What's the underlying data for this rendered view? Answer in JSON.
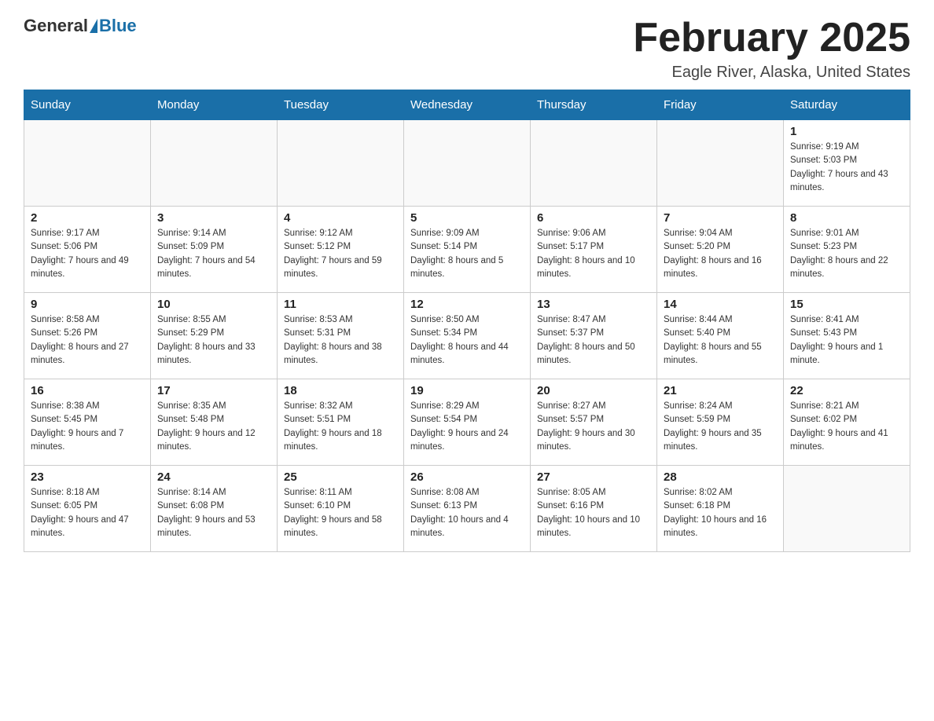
{
  "header": {
    "logo_general": "General",
    "logo_blue": "Blue",
    "title": "February 2025",
    "location": "Eagle River, Alaska, United States"
  },
  "weekdays": [
    "Sunday",
    "Monday",
    "Tuesday",
    "Wednesday",
    "Thursday",
    "Friday",
    "Saturday"
  ],
  "weeks": [
    [
      {
        "day": "",
        "sunrise": "",
        "sunset": "",
        "daylight": ""
      },
      {
        "day": "",
        "sunrise": "",
        "sunset": "",
        "daylight": ""
      },
      {
        "day": "",
        "sunrise": "",
        "sunset": "",
        "daylight": ""
      },
      {
        "day": "",
        "sunrise": "",
        "sunset": "",
        "daylight": ""
      },
      {
        "day": "",
        "sunrise": "",
        "sunset": "",
        "daylight": ""
      },
      {
        "day": "",
        "sunrise": "",
        "sunset": "",
        "daylight": ""
      },
      {
        "day": "1",
        "sunrise": "Sunrise: 9:19 AM",
        "sunset": "Sunset: 5:03 PM",
        "daylight": "Daylight: 7 hours and 43 minutes."
      }
    ],
    [
      {
        "day": "2",
        "sunrise": "Sunrise: 9:17 AM",
        "sunset": "Sunset: 5:06 PM",
        "daylight": "Daylight: 7 hours and 49 minutes."
      },
      {
        "day": "3",
        "sunrise": "Sunrise: 9:14 AM",
        "sunset": "Sunset: 5:09 PM",
        "daylight": "Daylight: 7 hours and 54 minutes."
      },
      {
        "day": "4",
        "sunrise": "Sunrise: 9:12 AM",
        "sunset": "Sunset: 5:12 PM",
        "daylight": "Daylight: 7 hours and 59 minutes."
      },
      {
        "day": "5",
        "sunrise": "Sunrise: 9:09 AM",
        "sunset": "Sunset: 5:14 PM",
        "daylight": "Daylight: 8 hours and 5 minutes."
      },
      {
        "day": "6",
        "sunrise": "Sunrise: 9:06 AM",
        "sunset": "Sunset: 5:17 PM",
        "daylight": "Daylight: 8 hours and 10 minutes."
      },
      {
        "day": "7",
        "sunrise": "Sunrise: 9:04 AM",
        "sunset": "Sunset: 5:20 PM",
        "daylight": "Daylight: 8 hours and 16 minutes."
      },
      {
        "day": "8",
        "sunrise": "Sunrise: 9:01 AM",
        "sunset": "Sunset: 5:23 PM",
        "daylight": "Daylight: 8 hours and 22 minutes."
      }
    ],
    [
      {
        "day": "9",
        "sunrise": "Sunrise: 8:58 AM",
        "sunset": "Sunset: 5:26 PM",
        "daylight": "Daylight: 8 hours and 27 minutes."
      },
      {
        "day": "10",
        "sunrise": "Sunrise: 8:55 AM",
        "sunset": "Sunset: 5:29 PM",
        "daylight": "Daylight: 8 hours and 33 minutes."
      },
      {
        "day": "11",
        "sunrise": "Sunrise: 8:53 AM",
        "sunset": "Sunset: 5:31 PM",
        "daylight": "Daylight: 8 hours and 38 minutes."
      },
      {
        "day": "12",
        "sunrise": "Sunrise: 8:50 AM",
        "sunset": "Sunset: 5:34 PM",
        "daylight": "Daylight: 8 hours and 44 minutes."
      },
      {
        "day": "13",
        "sunrise": "Sunrise: 8:47 AM",
        "sunset": "Sunset: 5:37 PM",
        "daylight": "Daylight: 8 hours and 50 minutes."
      },
      {
        "day": "14",
        "sunrise": "Sunrise: 8:44 AM",
        "sunset": "Sunset: 5:40 PM",
        "daylight": "Daylight: 8 hours and 55 minutes."
      },
      {
        "day": "15",
        "sunrise": "Sunrise: 8:41 AM",
        "sunset": "Sunset: 5:43 PM",
        "daylight": "Daylight: 9 hours and 1 minute."
      }
    ],
    [
      {
        "day": "16",
        "sunrise": "Sunrise: 8:38 AM",
        "sunset": "Sunset: 5:45 PM",
        "daylight": "Daylight: 9 hours and 7 minutes."
      },
      {
        "day": "17",
        "sunrise": "Sunrise: 8:35 AM",
        "sunset": "Sunset: 5:48 PM",
        "daylight": "Daylight: 9 hours and 12 minutes."
      },
      {
        "day": "18",
        "sunrise": "Sunrise: 8:32 AM",
        "sunset": "Sunset: 5:51 PM",
        "daylight": "Daylight: 9 hours and 18 minutes."
      },
      {
        "day": "19",
        "sunrise": "Sunrise: 8:29 AM",
        "sunset": "Sunset: 5:54 PM",
        "daylight": "Daylight: 9 hours and 24 minutes."
      },
      {
        "day": "20",
        "sunrise": "Sunrise: 8:27 AM",
        "sunset": "Sunset: 5:57 PM",
        "daylight": "Daylight: 9 hours and 30 minutes."
      },
      {
        "day": "21",
        "sunrise": "Sunrise: 8:24 AM",
        "sunset": "Sunset: 5:59 PM",
        "daylight": "Daylight: 9 hours and 35 minutes."
      },
      {
        "day": "22",
        "sunrise": "Sunrise: 8:21 AM",
        "sunset": "Sunset: 6:02 PM",
        "daylight": "Daylight: 9 hours and 41 minutes."
      }
    ],
    [
      {
        "day": "23",
        "sunrise": "Sunrise: 8:18 AM",
        "sunset": "Sunset: 6:05 PM",
        "daylight": "Daylight: 9 hours and 47 minutes."
      },
      {
        "day": "24",
        "sunrise": "Sunrise: 8:14 AM",
        "sunset": "Sunset: 6:08 PM",
        "daylight": "Daylight: 9 hours and 53 minutes."
      },
      {
        "day": "25",
        "sunrise": "Sunrise: 8:11 AM",
        "sunset": "Sunset: 6:10 PM",
        "daylight": "Daylight: 9 hours and 58 minutes."
      },
      {
        "day": "26",
        "sunrise": "Sunrise: 8:08 AM",
        "sunset": "Sunset: 6:13 PM",
        "daylight": "Daylight: 10 hours and 4 minutes."
      },
      {
        "day": "27",
        "sunrise": "Sunrise: 8:05 AM",
        "sunset": "Sunset: 6:16 PM",
        "daylight": "Daylight: 10 hours and 10 minutes."
      },
      {
        "day": "28",
        "sunrise": "Sunrise: 8:02 AM",
        "sunset": "Sunset: 6:18 PM",
        "daylight": "Daylight: 10 hours and 16 minutes."
      },
      {
        "day": "",
        "sunrise": "",
        "sunset": "",
        "daylight": ""
      }
    ]
  ]
}
